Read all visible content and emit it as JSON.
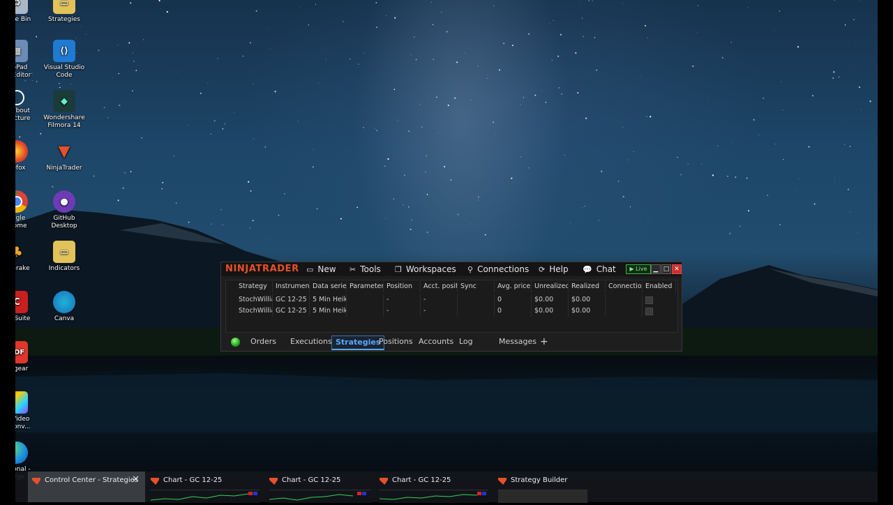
{
  "desktop_icons": [
    {
      "label": "cycle Bin",
      "icon": "recycle-bin-icon"
    },
    {
      "label": "Strategies",
      "icon": "folder-icon"
    },
    {
      "label": "otoPad\nge Editor",
      "icon": "photo-editor-icon"
    },
    {
      "label": "Visual Studio\nCode",
      "icon": "vscode-icon"
    },
    {
      "label": "rn about\ns picture",
      "icon": "info-icon"
    },
    {
      "label": "Wondershare\nFilmora 14",
      "icon": "filmora-icon"
    },
    {
      "label": "irefox",
      "icon": "firefox-icon"
    },
    {
      "label": "NinjaTrader",
      "icon": "ninjatrader-icon"
    },
    {
      "label": "oogle\nhrome",
      "icon": "chrome-icon"
    },
    {
      "label": "GitHub\nDesktop",
      "icon": "github-icon"
    },
    {
      "label": "ndBrake",
      "icon": "handbrake-icon"
    },
    {
      "label": "Indicators",
      "icon": "folder-icon"
    },
    {
      "label": "CH Suite",
      "icon": "ch-suite-icon"
    },
    {
      "label": "Canva",
      "icon": "canva-icon"
    },
    {
      "label": "DFgear",
      "icon": "pdf-icon"
    },
    {
      "label": "m Video\ne Conv...",
      "icon": "video-converter-icon"
    },
    {
      "label": "ersonal -\nEdge",
      "icon": "edge-icon"
    }
  ],
  "ninjatrader": {
    "logo": "NINJATRADER",
    "menu": {
      "new": "New",
      "tools": "Tools",
      "workspaces": "Workspaces",
      "connections": "Connections",
      "help": "Help",
      "chat": "Chat"
    },
    "live_label": "Live",
    "columns": [
      "Strategy",
      "Instrument",
      "Data series",
      "Parameters",
      "Position",
      "Acct. posit",
      "Sync",
      "Avg. price",
      "Unrealized",
      "Realized",
      "Connectio",
      "Enabled"
    ],
    "rows": [
      {
        "strategy": "StochWillia",
        "instrument": "GC 12-25",
        "data_series": "5 Min Heik",
        "parameters": "",
        "position": "-",
        "acct_position": "-",
        "sync": "",
        "avg_price": "0",
        "unrealized": "$0.00",
        "realized": "$0.00",
        "connection": ""
      },
      {
        "strategy": "StochWillia",
        "instrument": "GC 12-25",
        "data_series": "5 Min Heik",
        "parameters": "",
        "position": "-",
        "acct_position": "-",
        "sync": "",
        "avg_price": "0",
        "unrealized": "$0.00",
        "realized": "$0.00",
        "connection": ""
      }
    ],
    "tabs": {
      "orders": "Orders",
      "executions": "Executions",
      "strategies": "Strategies",
      "positions": "Positions",
      "accounts": "Accounts",
      "log": "Log",
      "messages": "Messages",
      "add": "+"
    },
    "active_tab": "Strategies"
  },
  "taskbar": {
    "items": [
      {
        "label": "Control Center - Strategies"
      },
      {
        "label": "Chart - GC 12-25"
      },
      {
        "label": "Chart - GC 12-25"
      },
      {
        "label": "Chart - GC 12-25"
      },
      {
        "label": "Strategy Builder"
      }
    ],
    "close_glyph": "✕"
  },
  "colors": {
    "brand": "#e8502a",
    "active_tab": "#5aa7ff",
    "live": "#3bb34a",
    "close": "#c9302c"
  }
}
